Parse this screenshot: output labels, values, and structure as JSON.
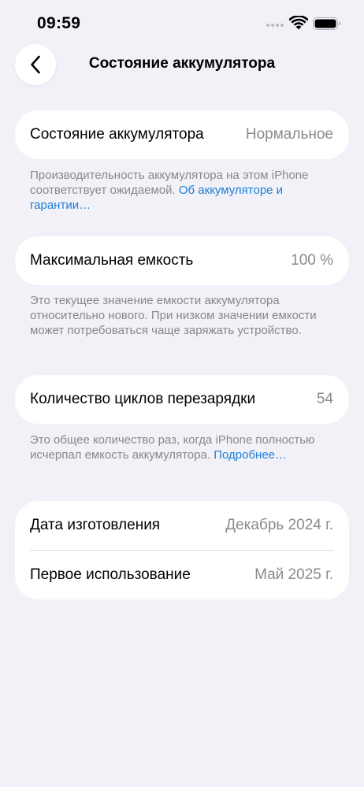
{
  "status_bar": {
    "time": "09:59"
  },
  "nav": {
    "title": "Состояние аккумулятора",
    "back_icon": "chevron-left-icon"
  },
  "battery_health": {
    "label": "Состояние аккумулятора",
    "value": "Нормальное",
    "footnote": "Производительность аккумулятора на этом iPhone соответствует ожидаемой. ",
    "link": "Об аккумуляторе и гарантии…"
  },
  "max_capacity": {
    "label": "Максимальная емкость",
    "value": "100 %",
    "footnote": "Это текущее значение емкости аккумулятора относительно нового. При низком значении емкости может потребоваться чаще заряжать устройство."
  },
  "cycle_count": {
    "label": "Количество циклов перезарядки",
    "value": "54",
    "footnote": "Это общее количество раз, когда iPhone полностью исчерпал емкость аккумулятора. ",
    "link": "Подробнее…"
  },
  "dates": {
    "manufacture_label": "Дата изготовления",
    "manufacture_value": "Декабрь 2024 г.",
    "first_use_label": "Первое использование",
    "first_use_value": "Май 2025 г."
  },
  "colors": {
    "background": "#f2f1f7",
    "card": "#ffffff",
    "link": "#1a7ed8",
    "secondary_text": "#8a8a8e"
  }
}
